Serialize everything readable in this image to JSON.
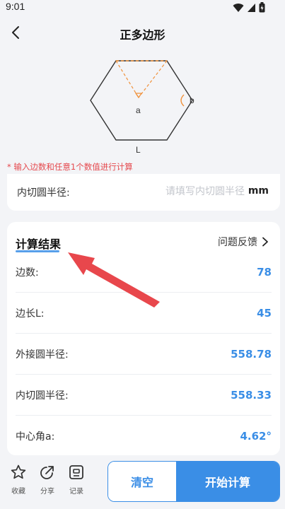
{
  "status_bar": {
    "time": "9:01"
  },
  "nav": {
    "title": "正多边形"
  },
  "diagram": {
    "label_a": "a",
    "label_b": "b",
    "label_L": "L"
  },
  "hint": "* 输入边数和任意1个数值进行计算",
  "input": {
    "label": "内切圆半径:",
    "placeholder": "请填写内切圆半径",
    "unit": "mm"
  },
  "results": {
    "title": "计算结果",
    "feedback_label": "问题反馈",
    "rows": [
      {
        "label": "边数:",
        "value": "78"
      },
      {
        "label": "边长L:",
        "value": "45"
      },
      {
        "label": "外接圆半径:",
        "value": "558.78"
      },
      {
        "label": "内切圆半径:",
        "value": "558.33"
      },
      {
        "label": "中心角a:",
        "value": "4.62°"
      }
    ]
  },
  "toolbar": {
    "collect_label": "收藏",
    "share_label": "分享",
    "record_label": "记录"
  },
  "buttons": {
    "clear_label": "清空",
    "start_label": "开始计算"
  },
  "colors": {
    "accent": "#3a8ee6",
    "hint": "#e5484d",
    "arrow": "#e8474c",
    "diagram_dash": "#f0913a"
  }
}
